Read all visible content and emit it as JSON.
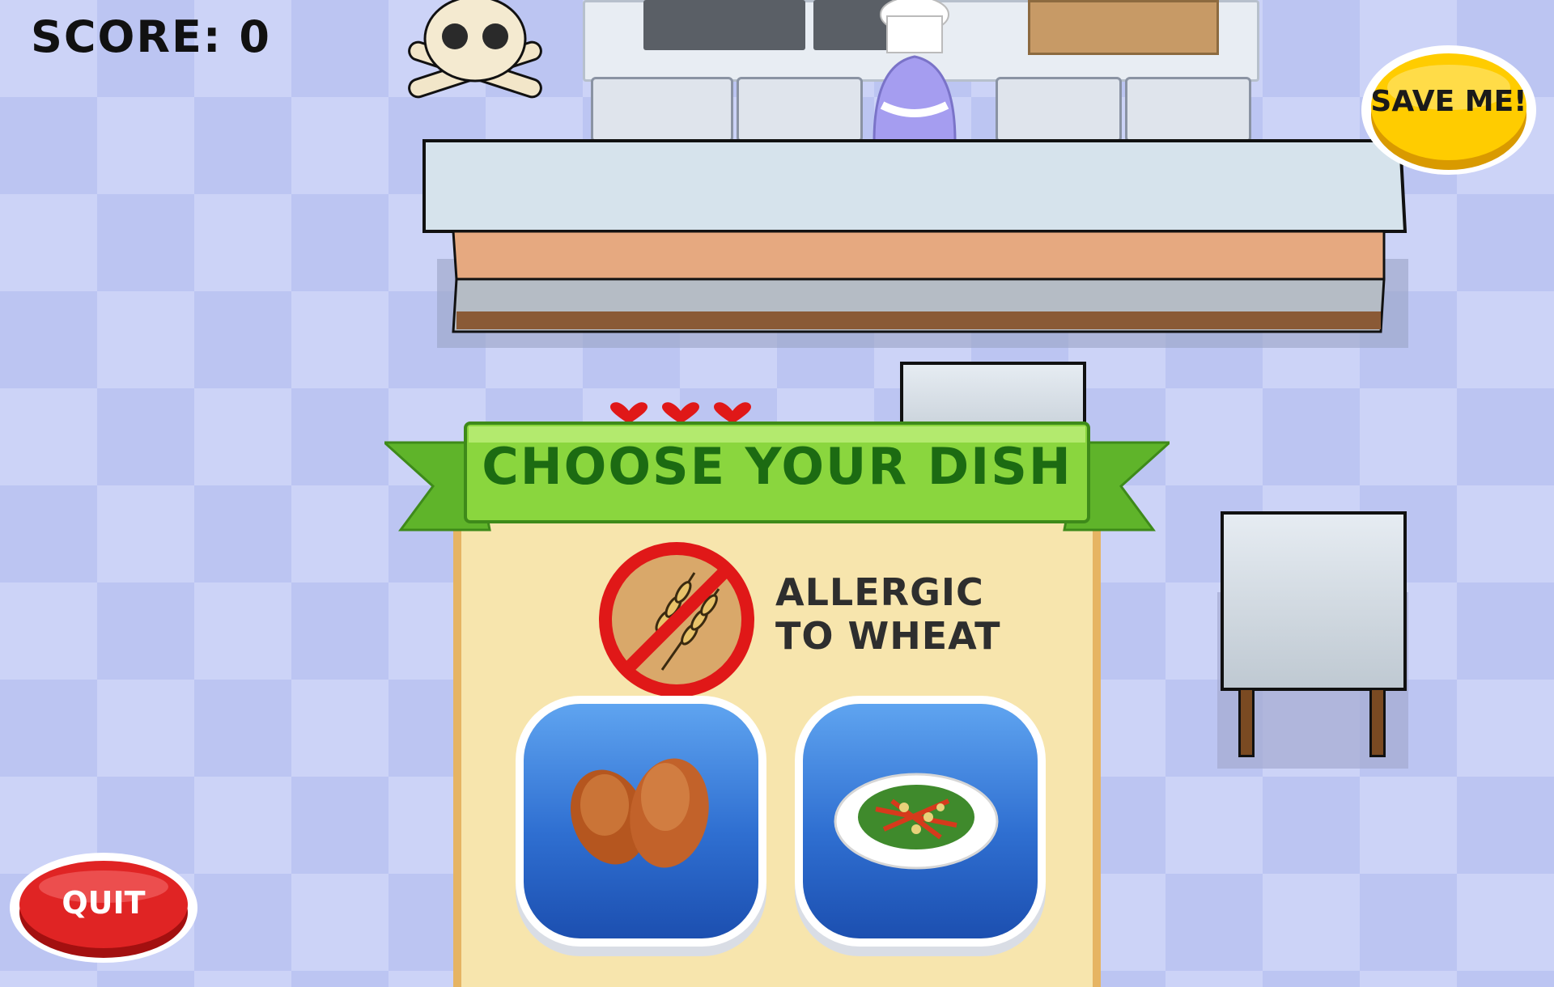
{
  "hud": {
    "score_label": "SCORE:",
    "score_value": "0"
  },
  "icons": {
    "skull": "skull-crossbones-icon",
    "no_wheat": "no-wheat-icon",
    "heart": "heart-icon"
  },
  "customer": {
    "hearts": 3
  },
  "dish_panel": {
    "title": "CHOOSE YOUR DISH",
    "allergy_line1": "ALLERGIC",
    "allergy_line2": "TO WHEAT",
    "options": [
      "fried-chicken-wings",
      "vegetable-salad"
    ]
  },
  "buttons": {
    "save_label": "SAVE ME!",
    "quit_label": "QUIT"
  },
  "colors": {
    "banner_green": "#7ed13c",
    "title_green": "#1c6b12",
    "save_yellow": "#ffcc00",
    "quit_red": "#e02424",
    "dish_blue": "#2f6fd1"
  }
}
